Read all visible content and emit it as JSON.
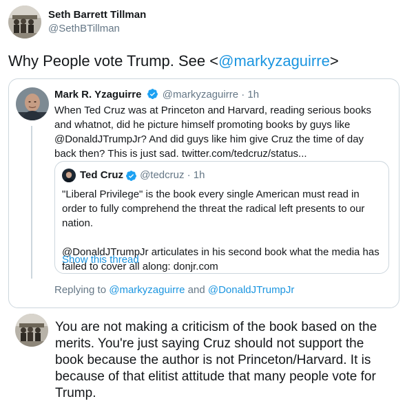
{
  "author": {
    "name": "Seth Barrett Tillman",
    "handle": "@SethBTillman"
  },
  "tweet": {
    "text_before": "Why People vote Trump. See <",
    "mention": "@markyzaguirre",
    "text_after": ">"
  },
  "quote": {
    "name": "Mark R. Yzaguirre",
    "handle_time": "@markyzaguirre · 1h",
    "text": "When Ted Cruz was at Princeton and Harvard, reading serious books and whatnot, did he picture himself promoting books by guys like @DonaldJTrumpJr? And did guys like him give Cruz the time of day back then? This is just sad. twitter.com/tedcruz/status...",
    "inner": {
      "name": "Ted Cruz",
      "handle_time": "@tedcruz · 1h",
      "paragraph1": "\"Liberal Privilege\" is the book every single American must read in order to fully comprehend the threat the radical left presents to our nation.",
      "paragraph2": "@DonaldJTrumpJr articulates in his second book what the media has failed to cover all along: donjr.com",
      "show_thread": "Show this thread"
    },
    "replying": {
      "prefix": "Replying to ",
      "user1": "@markyzaguirre",
      "and": " and ",
      "user2": "@DonaldJTrumpJr"
    }
  },
  "reply": {
    "text": "You are not making a criticism of the book based on the merits. You're just saying Cruz should not support the book because the author is not Princeton/Harvard. It is because of that elitist attitude that many people vote for Trump."
  },
  "colors": {
    "link": "#1b95e0",
    "muted": "#657786",
    "border": "#ccd6dd",
    "verified": "#1da1f2"
  },
  "icons": [
    "verified-badge-icon"
  ]
}
